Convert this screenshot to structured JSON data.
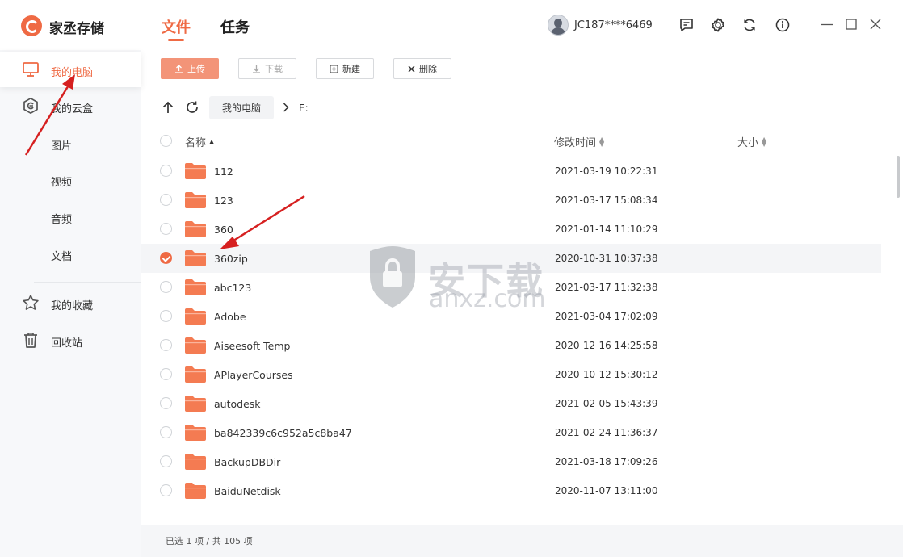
{
  "app": {
    "title": "家丞存储"
  },
  "main_tabs": [
    {
      "label": "文件",
      "active": true
    },
    {
      "label": "任务",
      "active": false
    }
  ],
  "user": {
    "name": "JC187****6469"
  },
  "header_icons": [
    "message-icon",
    "settings-icon",
    "refresh-sync-icon",
    "info-icon"
  ],
  "window_controls": [
    "minimize-icon",
    "maximize-icon",
    "close-icon"
  ],
  "sidebar": {
    "items": [
      {
        "label": "我的电脑",
        "icon": "monitor-icon",
        "active": true
      },
      {
        "label": "我的云盒",
        "icon": "cloud-box-icon",
        "active": false
      },
      {
        "label": "图片",
        "icon": "",
        "active": false
      },
      {
        "label": "视频",
        "icon": "",
        "active": false
      },
      {
        "label": "音频",
        "icon": "",
        "active": false
      },
      {
        "label": "文档",
        "icon": "",
        "active": false
      },
      {
        "label": "我的收藏",
        "icon": "star-icon",
        "active": false
      },
      {
        "label": "回收站",
        "icon": "trash-icon",
        "active": false
      }
    ]
  },
  "toolbar": {
    "upload": "上传",
    "download": "下载",
    "new": "新建",
    "delete": "删除"
  },
  "breadcrumb": {
    "root": "我的电脑",
    "current": "E:"
  },
  "table": {
    "columns": {
      "name": "名称",
      "modified": "修改时间",
      "size": "大小"
    },
    "rows": [
      {
        "name": "112",
        "modified": "2021-03-19 10:22:31",
        "selected": false
      },
      {
        "name": "123",
        "modified": "2021-03-17 15:08:34",
        "selected": false
      },
      {
        "name": "360",
        "modified": "2021-01-14 11:10:29",
        "selected": false
      },
      {
        "name": "360zip",
        "modified": "2020-10-31 10:37:38",
        "selected": true
      },
      {
        "name": "abc123",
        "modified": "2021-03-17 11:32:38",
        "selected": false
      },
      {
        "name": "Adobe",
        "modified": "2021-03-04 17:02:09",
        "selected": false
      },
      {
        "name": "Aiseesoft Temp",
        "modified": "2020-12-16 14:25:58",
        "selected": false
      },
      {
        "name": "APlayerCourses",
        "modified": "2020-10-12 15:30:12",
        "selected": false
      },
      {
        "name": "autodesk",
        "modified": "2021-02-05 15:43:39",
        "selected": false
      },
      {
        "name": "ba842339c6c952a5c8ba47",
        "modified": "2021-02-24 11:36:37",
        "selected": false
      },
      {
        "name": "BackupDBDir",
        "modified": "2021-03-18 17:09:26",
        "selected": false
      },
      {
        "name": "BaiduNetdisk",
        "modified": "2020-11-07 13:11:00",
        "selected": false
      }
    ]
  },
  "status": {
    "text": "已选 1 项 / 共 105 项"
  },
  "watermark": {
    "text": "安下载",
    "domain": "anxz.com"
  },
  "colors": {
    "accent": "#ef6a44",
    "accent_light": "#f39478",
    "folder": "#f47b52",
    "annotation": "#d62020"
  }
}
